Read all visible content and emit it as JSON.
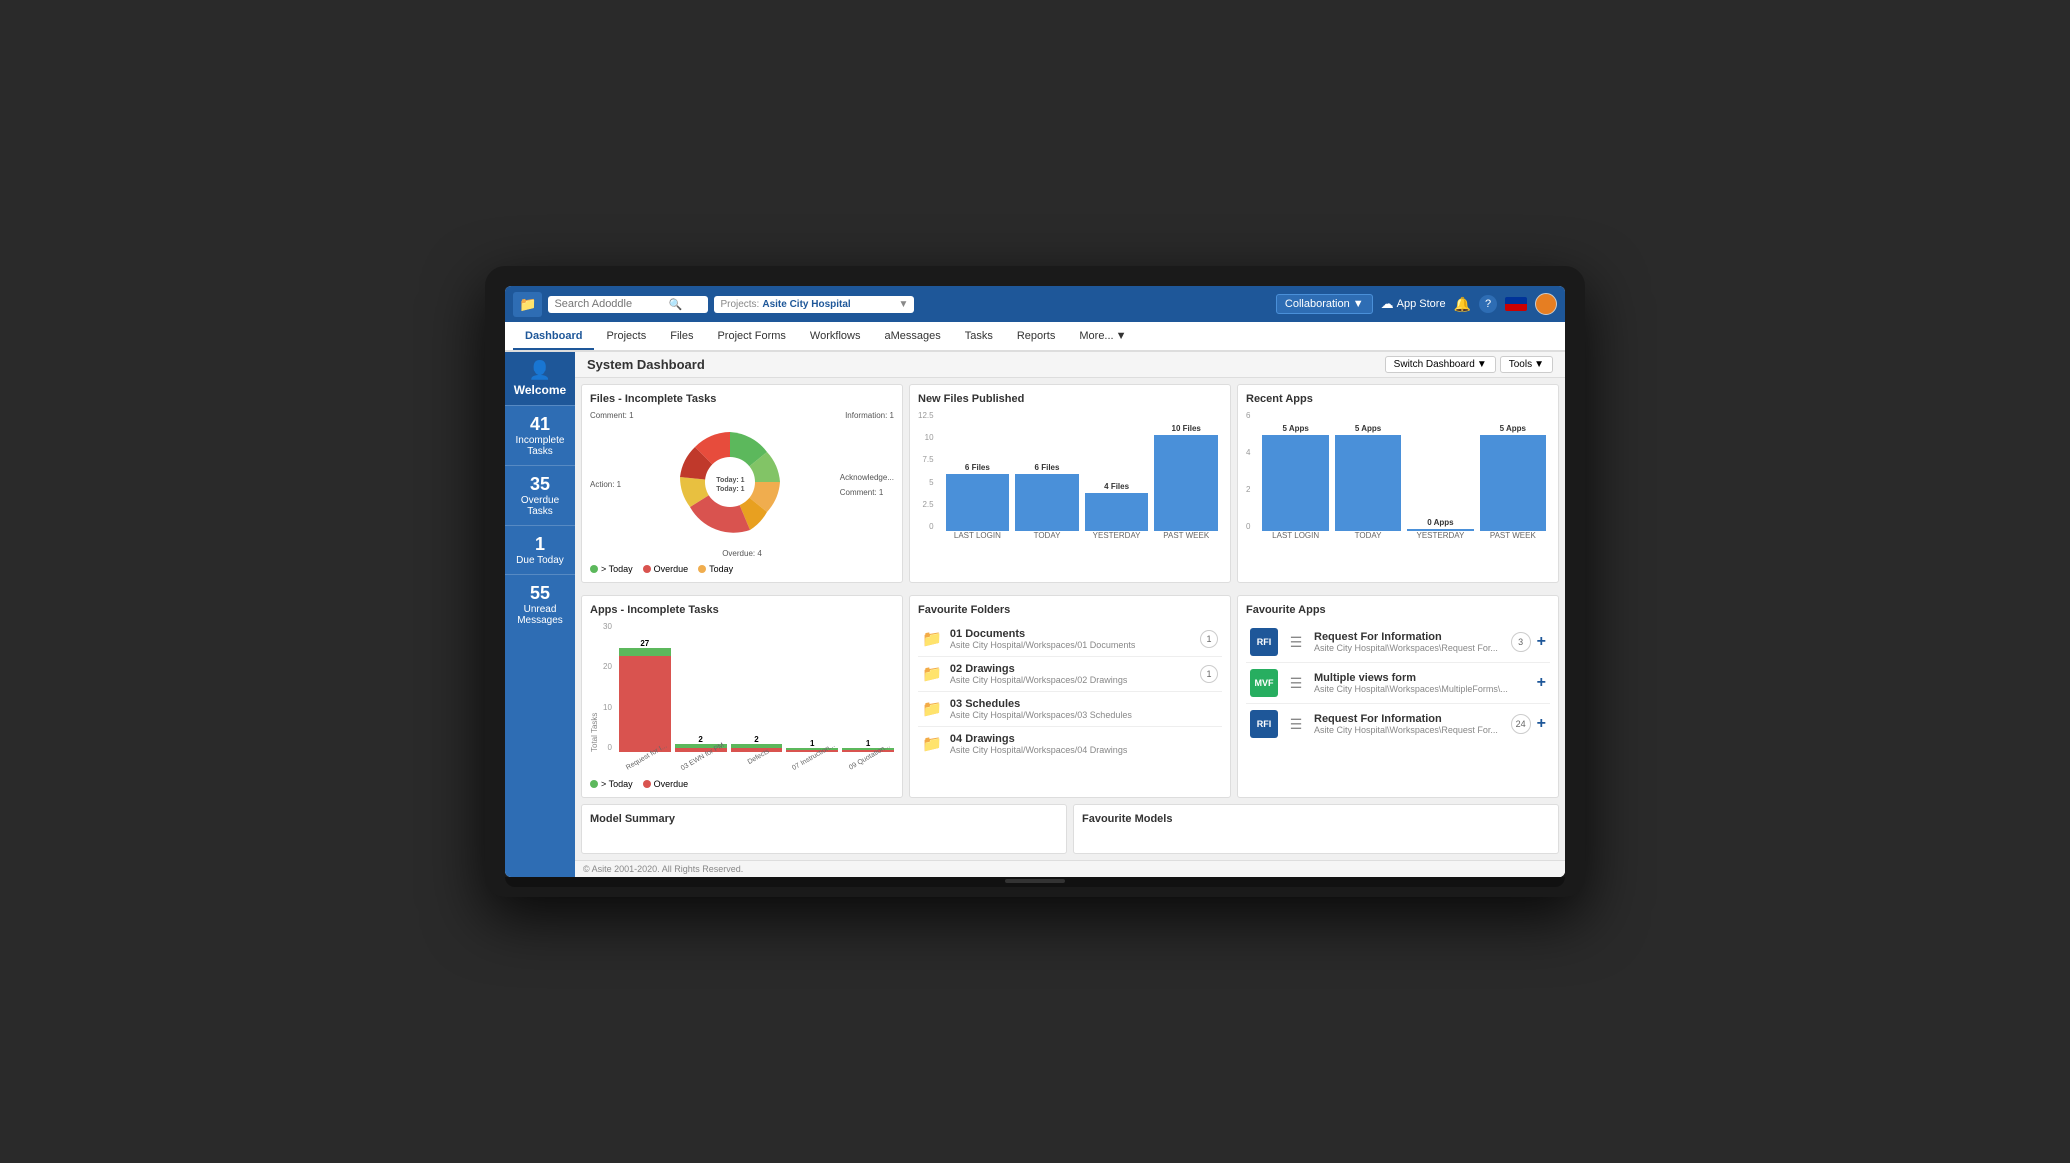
{
  "topbar": {
    "logo": "P",
    "search_placeholder": "Search Adoddle",
    "project_label": "Projects:",
    "project_value": "Asite City Hospital",
    "collab_label": "Collaboration",
    "appstore_label": "App Store"
  },
  "nav": {
    "items": [
      {
        "id": "dashboard",
        "label": "Dashboard",
        "active": true
      },
      {
        "id": "projects",
        "label": "Projects",
        "active": false
      },
      {
        "id": "files",
        "label": "Files",
        "active": false
      },
      {
        "id": "projectforms",
        "label": "Project Forms",
        "active": false
      },
      {
        "id": "workflows",
        "label": "Workflows",
        "active": false
      },
      {
        "id": "amessages",
        "label": "aMessages",
        "active": false
      },
      {
        "id": "tasks",
        "label": "Tasks",
        "active": false
      },
      {
        "id": "reports",
        "label": "Reports",
        "active": false
      },
      {
        "id": "more",
        "label": "More...",
        "active": false
      }
    ]
  },
  "sidebar": {
    "welcome_label": "Welcome",
    "stats": [
      {
        "num": "41",
        "label": "Incomplete Tasks"
      },
      {
        "num": "35",
        "label": "Overdue Tasks"
      },
      {
        "num": "1",
        "label": "Due Today"
      },
      {
        "num": "55",
        "label": "Unread Messages"
      }
    ]
  },
  "dashboard": {
    "title": "System Dashboard",
    "switch_label": "Switch Dashboard",
    "tools_label": "Tools"
  },
  "files_incomplete": {
    "title": "Files - Incomplete Tasks",
    "donut": {
      "segments": [
        {
          "label": "Comment: 1",
          "color": "#5cb85c",
          "value": 1
        },
        {
          "label": "Information: 1",
          "color": "#82c466",
          "value": 1
        },
        {
          "label": "Today: 1",
          "color": "#f0ad4e",
          "value": 1
        },
        {
          "label": "Today: 1",
          "color": "#e8a020",
          "value": 1
        },
        {
          "label": "Overdue: 4",
          "color": "#d9534f",
          "value": 4
        },
        {
          "label": "Acknowledge...",
          "color": "#e8c040",
          "value": 1
        },
        {
          "label": "Comment: 1",
          "color": "#c0392b",
          "value": 1
        },
        {
          "label": "Action: 1",
          "color": "#e74c3c",
          "value": 1
        }
      ]
    },
    "legend": [
      {
        "label": "> Today",
        "color": "#5cb85c"
      },
      {
        "label": "Overdue",
        "color": "#d9534f"
      },
      {
        "label": "Today",
        "color": "#f0ad4e"
      }
    ]
  },
  "new_files": {
    "title": "New Files Published",
    "bars": [
      {
        "label": "LAST LOGIN",
        "value": 6,
        "display": "6 Files"
      },
      {
        "label": "TODAY",
        "value": 6,
        "display": "6 Files"
      },
      {
        "label": "YESTERDAY",
        "value": 4,
        "display": "4 Files"
      },
      {
        "label": "PAST WEEK",
        "value": 10,
        "display": "10 Files"
      }
    ],
    "y_max": 12.5,
    "y_labels": [
      "12.5",
      "10",
      "7.5",
      "5",
      "2.5",
      "0"
    ]
  },
  "recent_apps": {
    "title": "Recent Apps",
    "bars": [
      {
        "label": "LAST LOGIN",
        "value": 5,
        "display": "5 Apps"
      },
      {
        "label": "TODAY",
        "value": 5,
        "display": "5 Apps"
      },
      {
        "label": "YESTERDAY",
        "value": 0,
        "display": "0 Apps"
      },
      {
        "label": "PAST WEEK",
        "value": 5,
        "display": "5 Apps"
      }
    ],
    "y_max": 6,
    "y_labels": [
      "6",
      "4",
      "2",
      "0"
    ]
  },
  "apps_incomplete": {
    "title": "Apps - Incomplete Tasks",
    "y_label": "Total Tasks",
    "bars": [
      {
        "label": "Request for I...",
        "green": 2,
        "red": 25,
        "orange": 0,
        "total": 27,
        "display_total": "27"
      },
      {
        "label": "03 EWN for PM",
        "green": 1,
        "red": 1,
        "orange": 0,
        "total": 2,
        "display_total": "2"
      },
      {
        "label": "Defects",
        "green": 1,
        "red": 1,
        "orange": 0,
        "total": 2,
        "display_total": "2"
      },
      {
        "label": "07 Instruction...",
        "green": 0,
        "red": 1,
        "orange": 0,
        "total": 1,
        "display_total": "1"
      },
      {
        "label": "09 Quotation...",
        "green": 0,
        "red": 1,
        "orange": 0,
        "total": 1,
        "display_total": "1"
      }
    ],
    "y_labels": [
      "30",
      "20",
      "10",
      "0"
    ],
    "legend": [
      {
        "label": "> Today",
        "color": "#5cb85c"
      },
      {
        "label": "Overdue",
        "color": "#d9534f"
      }
    ]
  },
  "favourite_folders": {
    "title": "Favourite Folders",
    "folders": [
      {
        "name": "01 Documents",
        "path": "Asite City Hospital/Workspaces/01 Documents",
        "badge": 1
      },
      {
        "name": "02 Drawings",
        "path": "Asite City Hospital/Workspaces/02 Drawings",
        "badge": 1
      },
      {
        "name": "03 Schedules",
        "path": "Asite City Hospital/Workspaces/03 Schedules",
        "badge": null
      },
      {
        "name": "04 Drawings",
        "path": "Asite City Hospital/Workspaces/04 Drawings",
        "badge": null
      }
    ]
  },
  "favourite_apps": {
    "title": "Favourite Apps",
    "apps": [
      {
        "icon": "RFI",
        "name": "Request For Information",
        "path": "Asite City Hospital\\Workspaces\\Request For...",
        "badge": 3
      },
      {
        "icon": "MVF",
        "name": "Multiple views form",
        "path": "Asite City Hospital\\Workspaces\\MultipleForms\\...",
        "badge": null
      },
      {
        "icon": "RFI",
        "name": "Request For Information",
        "path": "Asite City Hospital\\Workspaces\\Request For...",
        "badge": 24
      }
    ]
  },
  "model_summary": {
    "title": "Model Summary"
  },
  "favourite_models": {
    "title": "Favourite Models"
  },
  "footer": {
    "text": "© Asite 2001-2020. All Rights Reserved."
  }
}
